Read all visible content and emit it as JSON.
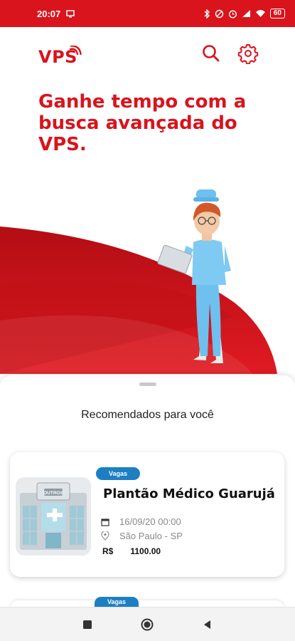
{
  "status_bar": {
    "time": "20:07",
    "battery": "60",
    "icons": [
      "screen-icon",
      "bluetooth-icon",
      "dnd-icon",
      "alarm-icon",
      "signal-icon",
      "wifi-icon"
    ]
  },
  "header": {
    "logo": "VPS",
    "search_icon": "search-icon",
    "settings_icon": "gear-icon"
  },
  "headline": "Ganhe tempo com a busca avançada do VPS.",
  "sheet": {
    "title": "Recomendados para você",
    "cards": [
      {
        "tag": "Vagas",
        "image_label": "OUTROS",
        "title": "Plantão Médico Guarujá",
        "date": "16/09/20 00:00",
        "location": "São Paulo - SP",
        "currency": "R$",
        "price": "1100.00"
      },
      {
        "tag": "Vagas"
      }
    ]
  },
  "colors": {
    "brand_red": "#d9141c",
    "tag_blue": "#1c7fc4"
  }
}
